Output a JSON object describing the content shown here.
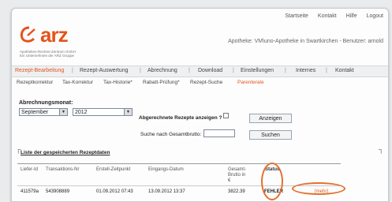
{
  "topnav": [
    "Startseite",
    "Kontakt",
    "Hilfe",
    "Logout"
  ],
  "logo": {
    "word": "arz",
    "sub1": "Apotheken-Rechen-Zentrum GmbH",
    "sub2": "Ein Unternehmen der ARZ Gruppe"
  },
  "user_line": "Apotheke: VM\\uno-Apotheke in Swartkirchen - Benutzer: arnold",
  "main_nav": [
    {
      "label": "Rezept-Bearbeitung",
      "active": true
    },
    {
      "label": "Rezept-Auswertung"
    },
    {
      "label": "Abrechnung"
    },
    {
      "label": "Download"
    },
    {
      "label": "Einstellungen"
    },
    {
      "label": "Internes"
    },
    {
      "label": "Kontakt"
    }
  ],
  "sub_nav": [
    {
      "label": "Rezeptkorrektur"
    },
    {
      "label": "Tax-Korrektur"
    },
    {
      "label": "Tax-Historie*"
    },
    {
      "label": "Rabatt-Prüfung*"
    },
    {
      "label": "Rezept-Suche"
    },
    {
      "label": "Parenterale",
      "active": true
    }
  ],
  "form": {
    "month_label": "Abrechnungsmonat:",
    "month_value": "September",
    "year_value": "2012",
    "billed_label": "Abgerechnete Rezepte anzeigen ?",
    "show_button": "Anzeigen",
    "search_label": "Suche nach Gesamtbrutto:",
    "search_value": "",
    "search_button": "Suchen"
  },
  "list_title": "Liste der gespeicherten Rezeptdaten",
  "table": {
    "headers": [
      "Liefer-Id",
      "Transaktions-Nr",
      "Erstell-Zeitpunkt",
      "Eingangs-Datum",
      "Gesamt-Brutto in €",
      "Status"
    ],
    "row": {
      "liefer_id": "411579a",
      "transaktion": "543908889",
      "erstellt": "01.09.2012 07:43",
      "eingang": "13.09.2012 13:37",
      "brutto": "3822.39",
      "status": "FEHLER",
      "action": "[mehr]"
    }
  },
  "colors": {
    "accent": "#e5531a",
    "highlight": "#e5702e"
  }
}
